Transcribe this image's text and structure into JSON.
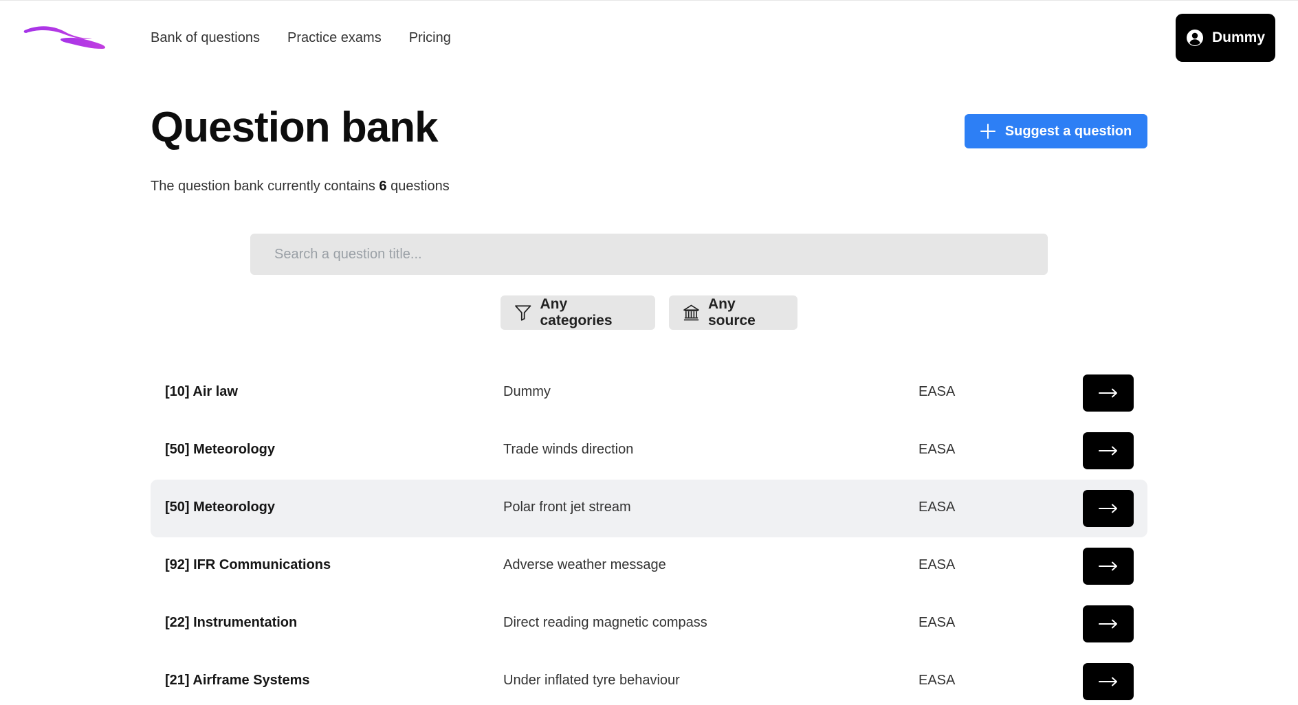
{
  "nav": {
    "items": [
      "Bank of questions",
      "Practice exams",
      "Pricing"
    ]
  },
  "user": {
    "name": "Dummy",
    "icon": "user-circle-icon"
  },
  "header": {
    "title": "Question bank",
    "suggest_label": "Suggest a question",
    "suggest_icon": "plus-icon",
    "count_prefix": "The question bank currently contains",
    "count": "6",
    "count_suffix": "questions"
  },
  "search": {
    "placeholder": "Search a question title..."
  },
  "filters": {
    "categories": {
      "label": "Any categories",
      "icon": "funnel-icon"
    },
    "source": {
      "label": "Any source",
      "icon": "bank-icon"
    }
  },
  "colors": {
    "brand": "#a033e8",
    "accent": "#2d7ff5",
    "dark": "#000000",
    "row_highlight": "#f0f1f3"
  },
  "questions": [
    {
      "category": "[10] Air law",
      "title": "Dummy",
      "source": "EASA"
    },
    {
      "category": "[50] Meteorology",
      "title": "Trade winds direction",
      "source": "EASA"
    },
    {
      "category": "[50] Meteorology",
      "title": "Polar front jet stream",
      "source": "EASA"
    },
    {
      "category": "[92] IFR Communications",
      "title": "Adverse weather message",
      "source": "EASA"
    },
    {
      "category": "[22] Instrumentation",
      "title": "Direct reading magnetic compass",
      "source": "EASA"
    },
    {
      "category": "[21] Airframe Systems",
      "title": "Under inflated tyre behaviour",
      "source": "EASA"
    }
  ]
}
